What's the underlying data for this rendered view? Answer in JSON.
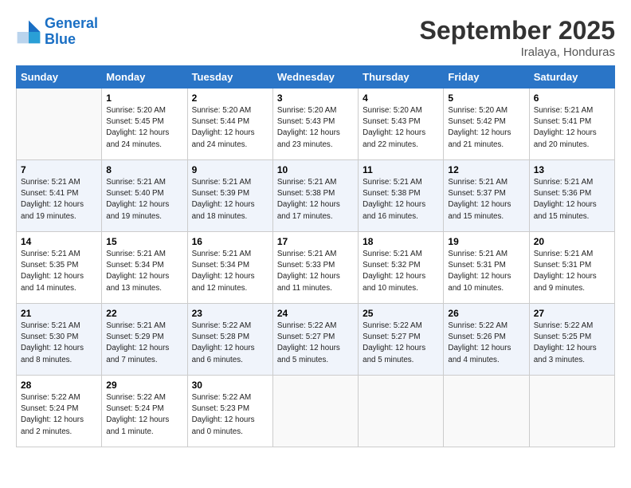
{
  "header": {
    "logo_line1": "General",
    "logo_line2": "Blue",
    "month": "September 2025",
    "location": "Iralaya, Honduras"
  },
  "weekdays": [
    "Sunday",
    "Monday",
    "Tuesday",
    "Wednesday",
    "Thursday",
    "Friday",
    "Saturday"
  ],
  "weeks": [
    [
      {
        "day": "",
        "info": ""
      },
      {
        "day": "1",
        "info": "Sunrise: 5:20 AM\nSunset: 5:45 PM\nDaylight: 12 hours\nand 24 minutes."
      },
      {
        "day": "2",
        "info": "Sunrise: 5:20 AM\nSunset: 5:44 PM\nDaylight: 12 hours\nand 24 minutes."
      },
      {
        "day": "3",
        "info": "Sunrise: 5:20 AM\nSunset: 5:43 PM\nDaylight: 12 hours\nand 23 minutes."
      },
      {
        "day": "4",
        "info": "Sunrise: 5:20 AM\nSunset: 5:43 PM\nDaylight: 12 hours\nand 22 minutes."
      },
      {
        "day": "5",
        "info": "Sunrise: 5:20 AM\nSunset: 5:42 PM\nDaylight: 12 hours\nand 21 minutes."
      },
      {
        "day": "6",
        "info": "Sunrise: 5:21 AM\nSunset: 5:41 PM\nDaylight: 12 hours\nand 20 minutes."
      }
    ],
    [
      {
        "day": "7",
        "info": "Sunrise: 5:21 AM\nSunset: 5:41 PM\nDaylight: 12 hours\nand 19 minutes."
      },
      {
        "day": "8",
        "info": "Sunrise: 5:21 AM\nSunset: 5:40 PM\nDaylight: 12 hours\nand 19 minutes."
      },
      {
        "day": "9",
        "info": "Sunrise: 5:21 AM\nSunset: 5:39 PM\nDaylight: 12 hours\nand 18 minutes."
      },
      {
        "day": "10",
        "info": "Sunrise: 5:21 AM\nSunset: 5:38 PM\nDaylight: 12 hours\nand 17 minutes."
      },
      {
        "day": "11",
        "info": "Sunrise: 5:21 AM\nSunset: 5:38 PM\nDaylight: 12 hours\nand 16 minutes."
      },
      {
        "day": "12",
        "info": "Sunrise: 5:21 AM\nSunset: 5:37 PM\nDaylight: 12 hours\nand 15 minutes."
      },
      {
        "day": "13",
        "info": "Sunrise: 5:21 AM\nSunset: 5:36 PM\nDaylight: 12 hours\nand 15 minutes."
      }
    ],
    [
      {
        "day": "14",
        "info": "Sunrise: 5:21 AM\nSunset: 5:35 PM\nDaylight: 12 hours\nand 14 minutes."
      },
      {
        "day": "15",
        "info": "Sunrise: 5:21 AM\nSunset: 5:34 PM\nDaylight: 12 hours\nand 13 minutes."
      },
      {
        "day": "16",
        "info": "Sunrise: 5:21 AM\nSunset: 5:34 PM\nDaylight: 12 hours\nand 12 minutes."
      },
      {
        "day": "17",
        "info": "Sunrise: 5:21 AM\nSunset: 5:33 PM\nDaylight: 12 hours\nand 11 minutes."
      },
      {
        "day": "18",
        "info": "Sunrise: 5:21 AM\nSunset: 5:32 PM\nDaylight: 12 hours\nand 10 minutes."
      },
      {
        "day": "19",
        "info": "Sunrise: 5:21 AM\nSunset: 5:31 PM\nDaylight: 12 hours\nand 10 minutes."
      },
      {
        "day": "20",
        "info": "Sunrise: 5:21 AM\nSunset: 5:31 PM\nDaylight: 12 hours\nand 9 minutes."
      }
    ],
    [
      {
        "day": "21",
        "info": "Sunrise: 5:21 AM\nSunset: 5:30 PM\nDaylight: 12 hours\nand 8 minutes."
      },
      {
        "day": "22",
        "info": "Sunrise: 5:21 AM\nSunset: 5:29 PM\nDaylight: 12 hours\nand 7 minutes."
      },
      {
        "day": "23",
        "info": "Sunrise: 5:22 AM\nSunset: 5:28 PM\nDaylight: 12 hours\nand 6 minutes."
      },
      {
        "day": "24",
        "info": "Sunrise: 5:22 AM\nSunset: 5:27 PM\nDaylight: 12 hours\nand 5 minutes."
      },
      {
        "day": "25",
        "info": "Sunrise: 5:22 AM\nSunset: 5:27 PM\nDaylight: 12 hours\nand 5 minutes."
      },
      {
        "day": "26",
        "info": "Sunrise: 5:22 AM\nSunset: 5:26 PM\nDaylight: 12 hours\nand 4 minutes."
      },
      {
        "day": "27",
        "info": "Sunrise: 5:22 AM\nSunset: 5:25 PM\nDaylight: 12 hours\nand 3 minutes."
      }
    ],
    [
      {
        "day": "28",
        "info": "Sunrise: 5:22 AM\nSunset: 5:24 PM\nDaylight: 12 hours\nand 2 minutes."
      },
      {
        "day": "29",
        "info": "Sunrise: 5:22 AM\nSunset: 5:24 PM\nDaylight: 12 hours\nand 1 minute."
      },
      {
        "day": "30",
        "info": "Sunrise: 5:22 AM\nSunset: 5:23 PM\nDaylight: 12 hours\nand 0 minutes."
      },
      {
        "day": "",
        "info": ""
      },
      {
        "day": "",
        "info": ""
      },
      {
        "day": "",
        "info": ""
      },
      {
        "day": "",
        "info": ""
      }
    ]
  ]
}
